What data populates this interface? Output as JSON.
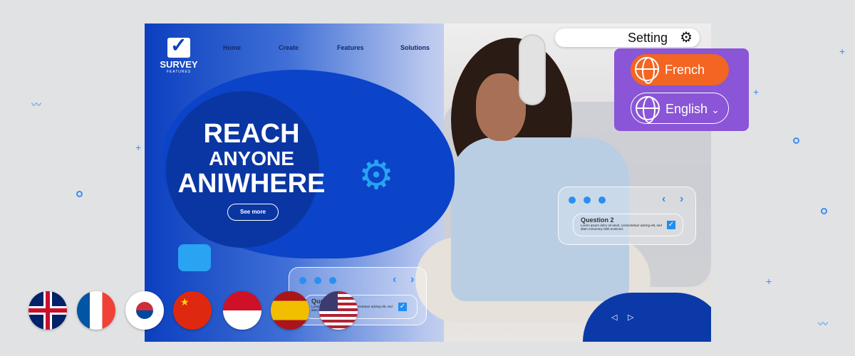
{
  "brand": {
    "name": "SURVEY",
    "sub": "FEATURES"
  },
  "nav": [
    {
      "label": "Home"
    },
    {
      "label": "Create"
    },
    {
      "label": "Features"
    },
    {
      "label": "Solutions"
    }
  ],
  "hero": {
    "line1": "REACH",
    "line2": "ANYONE",
    "line3": "ANIWHERE",
    "cta": "See more"
  },
  "cards": [
    {
      "title": "Question 2",
      "text": "Lorem ipsum dolor sit amet, consectetuer adcing elit, sed diam nonummy nibh euismod.",
      "checked": true
    },
    {
      "title": "Question",
      "text": "Lorem ipsum dolor sit amet, consectetuer adcing elit, sed diam nonummy nibh euismod.",
      "checked": true
    }
  ],
  "setting": {
    "label": "Setting",
    "icon": "gear-icon"
  },
  "languages": [
    {
      "label": "French",
      "color": "#f26522"
    },
    {
      "label": "English",
      "color": "#8a55d6"
    }
  ],
  "flags": [
    "United Kingdom",
    "France",
    "South Korea",
    "China",
    "Indonesia",
    "Spain",
    "United States"
  ],
  "colors": {
    "primary": "#0b43c9",
    "accent": "#2a8ff5",
    "panel": "#8a55d6"
  }
}
